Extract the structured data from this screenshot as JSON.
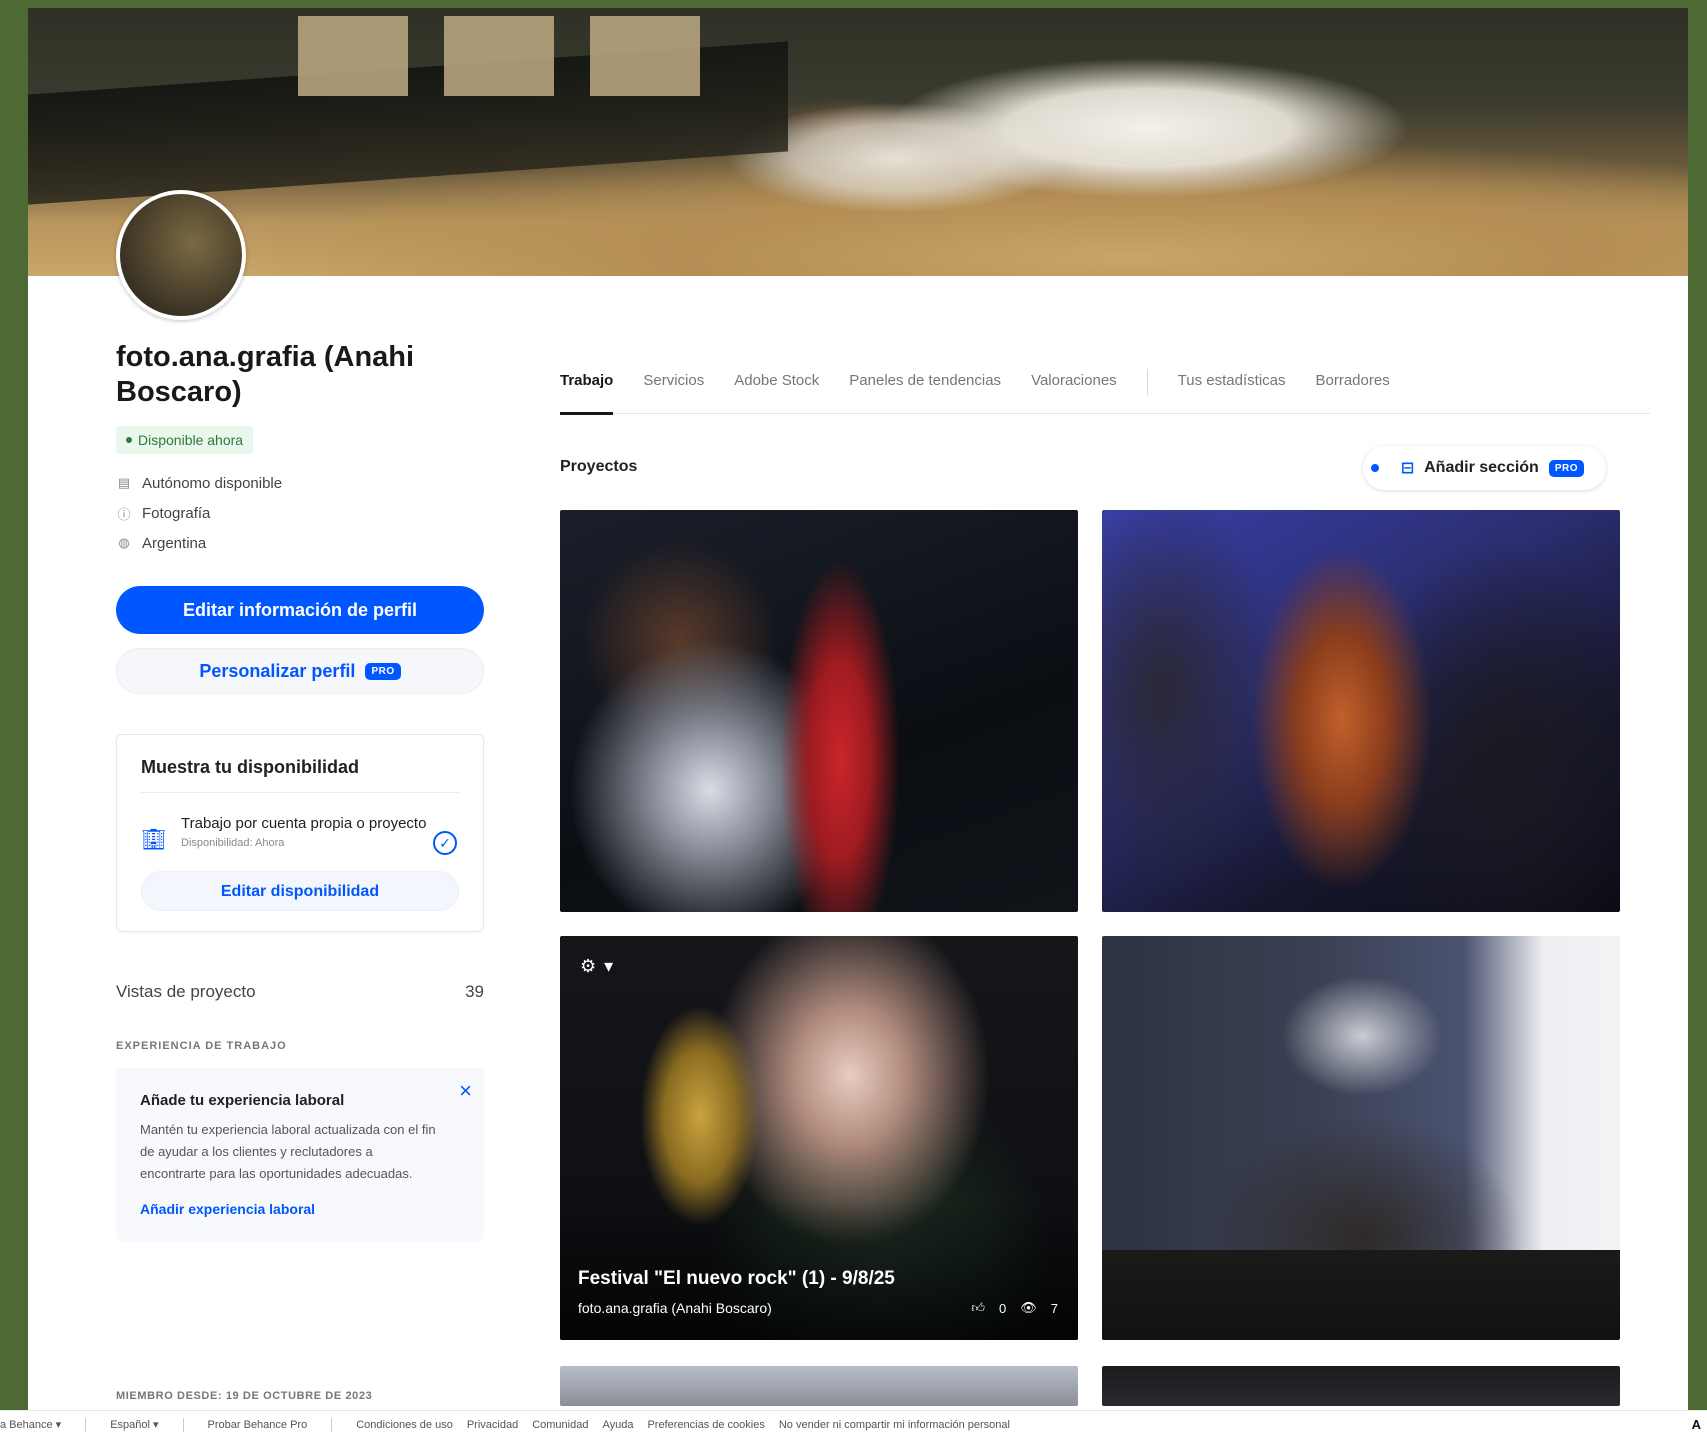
{
  "profile": {
    "name": "foto.ana.grafia (Anahi Boscaro)",
    "status": "Disponible ahora",
    "meta": [
      {
        "icon": "briefcase-icon",
        "text": "Autónomo disponible"
      },
      {
        "icon": "info-icon",
        "text": "Fotografía"
      },
      {
        "icon": "globe-icon",
        "text": "Argentina"
      }
    ],
    "edit_button": "Editar información de perfil",
    "customize_button": "Personalizar perfil",
    "pro_badge": "PRO"
  },
  "availability": {
    "title": "Muestra tu disponibilidad",
    "item_label": "Trabajo por cuenta propia o proyecto",
    "item_sub": "Disponibilidad: Ahora",
    "edit_button": "Editar disponibilidad"
  },
  "stats": {
    "views_label": "Vistas de proyecto",
    "views_value": "39"
  },
  "experience": {
    "section_label": "EXPERIENCIA DE TRABAJO",
    "card_title": "Añade tu experiencia laboral",
    "card_body": "Mantén tu experiencia laboral actualizada con el fin de ayudar a los clientes y reclutadores a encontrarte para las oportunidades adecuadas.",
    "card_link": "Añadir experiencia laboral"
  },
  "member_since": "MIEMBRO DESDE: 19 DE OCTUBRE DE 2023",
  "tabs": [
    "Trabajo",
    "Servicios",
    "Adobe Stock",
    "Paneles de tendencias",
    "Valoraciones",
    "Tus estadísticas",
    "Borradores"
  ],
  "projects": {
    "heading": "Proyectos",
    "add_section": "Añadir sección",
    "featured": {
      "title": "Festival \"El nuevo rock\" (1) - 9/8/25",
      "owner": "foto.ana.grafia (Anahi Boscaro)",
      "likes": "0",
      "views": "7"
    }
  },
  "footer": {
    "items": [
      "a Behance ▾",
      "Español ▾",
      "Probar Behance Pro",
      "Condiciones de uso",
      "Privacidad",
      "Comunidad",
      "Ayuda",
      "Preferencias de cookies",
      "No vender ni compartir mi información personal"
    ],
    "brand": "A"
  },
  "colors": {
    "accent": "#0057ff",
    "available": "#2a7b3d",
    "background": "#4e6a34"
  }
}
